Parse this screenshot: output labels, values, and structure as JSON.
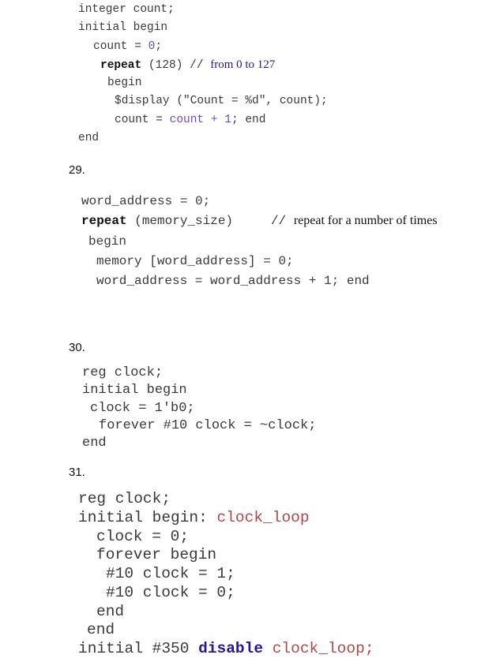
{
  "snippet_28": {
    "lines": [
      "integer count;",
      "initial begin",
      "count = ",
      "0",
      ";",
      "repeat",
      " (128) // ",
      "from 0 to 127",
      "begin",
      "$display (\"Count = %d\", count);",
      "count = ",
      "count + 1",
      "; end",
      "end"
    ]
  },
  "question_29": {
    "number": "29.",
    "lines": [
      "word_address = 0;",
      "repeat",
      " (memory_size)     // ",
      "repeat for a number of times",
      "begin",
      "memory [word_address] = 0;",
      "word_address = word_address + 1; end"
    ]
  },
  "question_30": {
    "number": "30.",
    "lines": [
      "reg clock;",
      "initial begin",
      "clock = 1'b0;",
      "forever #10 clock = ~clock;",
      "end"
    ]
  },
  "question_31": {
    "number": "31.",
    "lines": [
      "reg clock;",
      "initial begin: ",
      "clock_loop",
      "clock = 0;",
      "forever begin",
      "#10 clock = 1;",
      "#10 clock = 0;",
      "end",
      "end",
      "initial #350 ",
      "disable",
      " ",
      "clock_loop;"
    ]
  },
  "colors": {
    "code_text": "#3a3a3a",
    "keyword_blue": "#2a1499",
    "number_purple": "#6a4bd0",
    "label_red": "#b04848"
  }
}
